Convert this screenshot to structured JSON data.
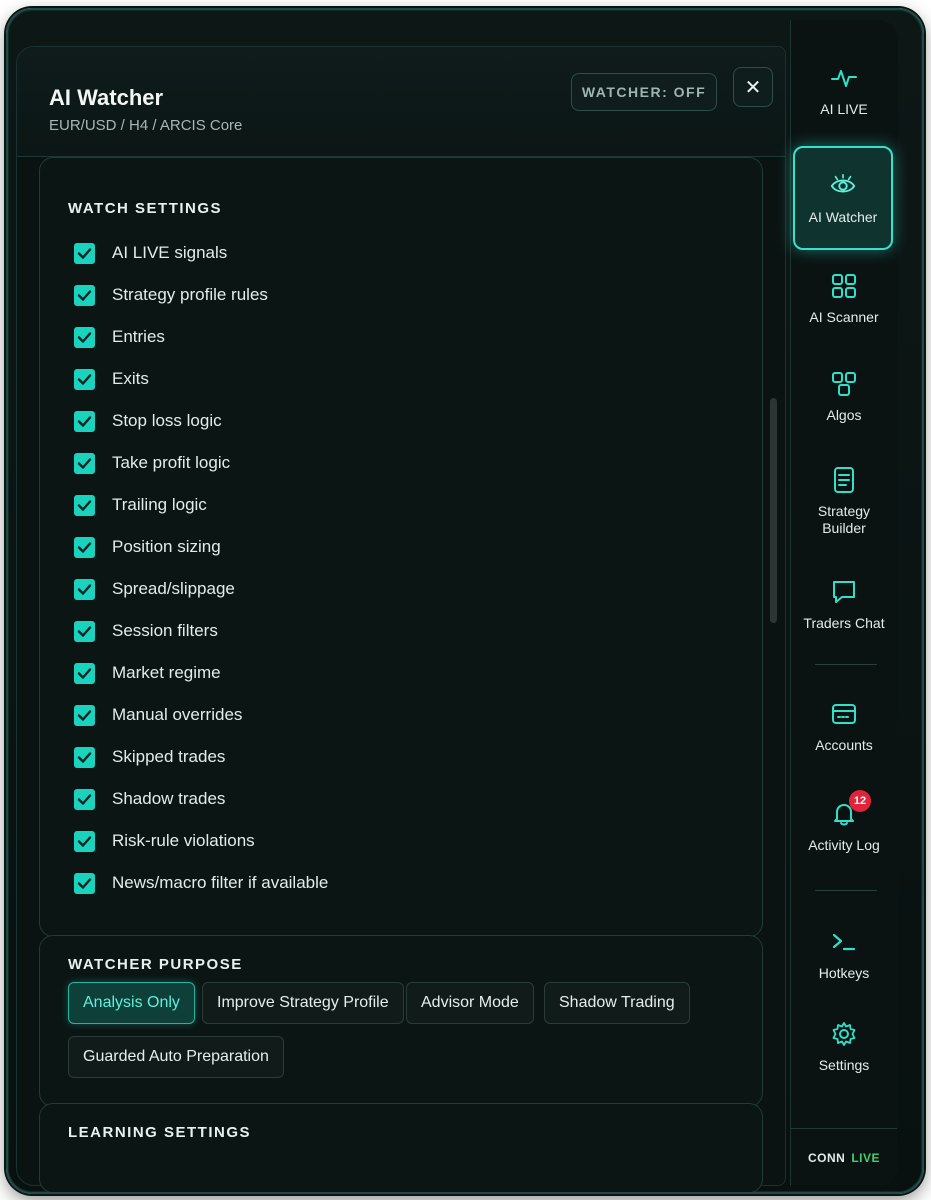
{
  "header": {
    "title": "AI Watcher",
    "subtitle": "EUR/USD / H4 / ARCIS Core",
    "watcher_status": "WATCHER: OFF",
    "close_label": "✕"
  },
  "watch_settings": {
    "title": "WATCH SETTINGS",
    "items": [
      {
        "label": "AI LIVE signals",
        "checked": true
      },
      {
        "label": "Strategy profile rules",
        "checked": true
      },
      {
        "label": "Entries",
        "checked": true
      },
      {
        "label": "Exits",
        "checked": true
      },
      {
        "label": "Stop loss logic",
        "checked": true
      },
      {
        "label": "Take profit logic",
        "checked": true
      },
      {
        "label": "Trailing logic",
        "checked": true
      },
      {
        "label": "Position sizing",
        "checked": true
      },
      {
        "label": "Spread/slippage",
        "checked": true
      },
      {
        "label": "Session filters",
        "checked": true
      },
      {
        "label": "Market regime",
        "checked": true
      },
      {
        "label": "Manual overrides",
        "checked": true
      },
      {
        "label": "Skipped trades",
        "checked": true
      },
      {
        "label": "Shadow trades",
        "checked": true
      },
      {
        "label": "Risk-rule violations",
        "checked": true
      },
      {
        "label": "News/macro filter if available",
        "checked": true
      }
    ]
  },
  "watcher_purpose": {
    "title": "WATCHER PURPOSE",
    "options": [
      {
        "label": "Analysis Only",
        "selected": true
      },
      {
        "label": "Improve Strategy Profile",
        "selected": false
      },
      {
        "label": "Advisor Mode",
        "selected": false
      },
      {
        "label": "Shadow Trading",
        "selected": false
      },
      {
        "label": "Guarded Auto Preparation",
        "selected": false
      }
    ]
  },
  "learning_settings": {
    "title": "LEARNING SETTINGS"
  },
  "sidebar": {
    "items": [
      {
        "label": "AI LIVE",
        "icon": "pulse-icon",
        "active": false
      },
      {
        "label": "AI Watcher",
        "icon": "eye-icon",
        "active": true
      },
      {
        "label": "AI Scanner",
        "icon": "grid-icon",
        "active": false
      },
      {
        "label": "Algos",
        "icon": "blocks-icon",
        "active": false
      },
      {
        "label": "Strategy Builder",
        "icon": "document-icon",
        "active": false
      },
      {
        "label": "Traders Chat",
        "icon": "chat-icon",
        "active": false
      },
      {
        "label": "Accounts",
        "icon": "card-icon",
        "active": false
      },
      {
        "label": "Activity Log",
        "icon": "bell-icon",
        "active": false,
        "badge": "12"
      },
      {
        "label": "Hotkeys",
        "icon": "terminal-icon",
        "active": false
      },
      {
        "label": "Settings",
        "icon": "gear-icon",
        "active": false
      }
    ],
    "conn_label": "CONN",
    "conn_status": "LIVE"
  },
  "colors": {
    "accent": "#19d3bf",
    "active_border": "#36e2cd",
    "live_green": "#3ed26a",
    "badge_red": "#e0243a",
    "background": "#0a1312"
  }
}
